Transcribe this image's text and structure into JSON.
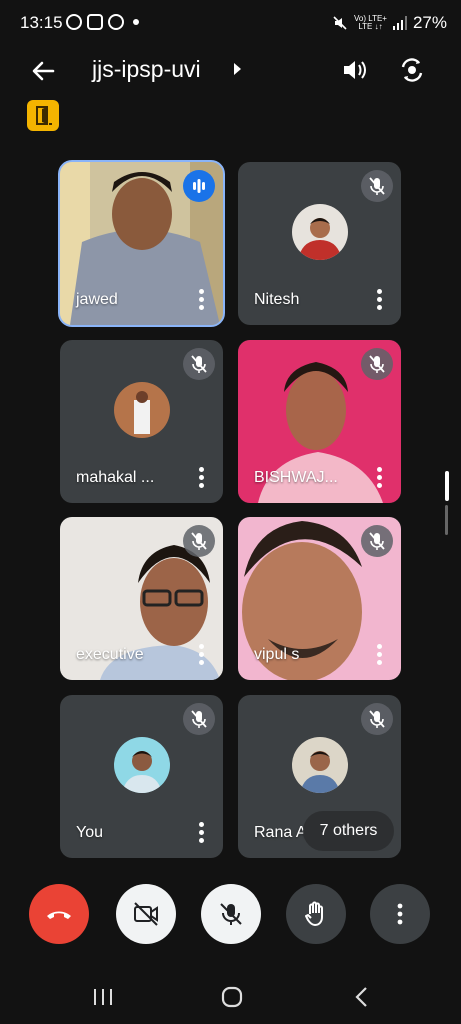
{
  "status_bar": {
    "time": "13:15",
    "network_label": "Vo) LTE+\nLTE ↓↑",
    "battery": "27%"
  },
  "header": {
    "meeting_title": "jjs-ipsp-uvi"
  },
  "participants": [
    {
      "name": "jawed",
      "muted": false,
      "speaking": true
    },
    {
      "name": "Nitesh",
      "muted": true
    },
    {
      "name": "mahakal ...",
      "muted": true
    },
    {
      "name": "BISHWAJ...",
      "muted": true
    },
    {
      "name": "executive",
      "muted": true
    },
    {
      "name": "vipul s",
      "muted": true
    },
    {
      "name": "You",
      "muted": true
    },
    {
      "name": "Rana A",
      "muted": true
    }
  ],
  "others_chip": {
    "label": "7 others"
  },
  "controls": {
    "end_call_icon": "phone-hangup-icon",
    "camera_icon": "camera-off-icon",
    "mic_icon": "mic-off-icon",
    "hand_icon": "raise-hand-icon",
    "more_icon": "more-vert-icon"
  },
  "colors": {
    "end_call": "#ea4335",
    "tile_bg": "#3c4043",
    "active_outline": "#8ab4f8",
    "badge": "#f4b400"
  }
}
